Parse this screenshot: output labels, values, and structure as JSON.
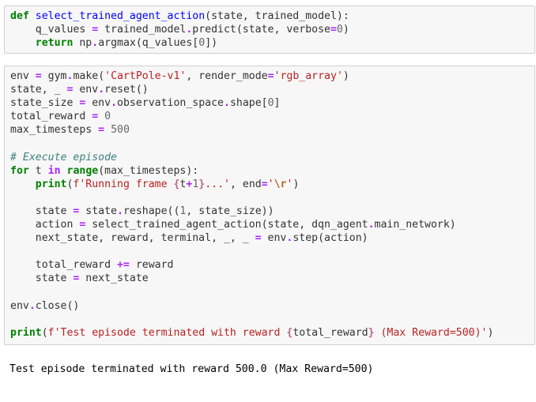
{
  "cells": [
    {
      "lines": [
        [
          {
            "t": "def",
            "c": "kw"
          },
          {
            "t": " ",
            "c": "plain"
          },
          {
            "t": "select_trained_agent_action",
            "c": "fn"
          },
          {
            "t": "(state, trained_model):",
            "c": "plain"
          }
        ],
        [
          {
            "t": "    q_values ",
            "c": "plain"
          },
          {
            "t": "=",
            "c": "op"
          },
          {
            "t": " trained_model",
            "c": "plain"
          },
          {
            "t": ".",
            "c": "op"
          },
          {
            "t": "predict(state, verbose",
            "c": "plain"
          },
          {
            "t": "=",
            "c": "op"
          },
          {
            "t": "0",
            "c": "num"
          },
          {
            "t": ")",
            "c": "plain"
          }
        ],
        [
          {
            "t": "    ",
            "c": "plain"
          },
          {
            "t": "return",
            "c": "kw"
          },
          {
            "t": " np",
            "c": "plain"
          },
          {
            "t": ".",
            "c": "op"
          },
          {
            "t": "argmax(q_values[",
            "c": "plain"
          },
          {
            "t": "0",
            "c": "num"
          },
          {
            "t": "])",
            "c": "plain"
          }
        ]
      ]
    },
    {
      "lines": [
        [
          {
            "t": "env ",
            "c": "plain"
          },
          {
            "t": "=",
            "c": "op"
          },
          {
            "t": " gym",
            "c": "plain"
          },
          {
            "t": ".",
            "c": "op"
          },
          {
            "t": "make(",
            "c": "plain"
          },
          {
            "t": "'CartPole-v1'",
            "c": "str"
          },
          {
            "t": ", render_mode",
            "c": "plain"
          },
          {
            "t": "=",
            "c": "op"
          },
          {
            "t": "'rgb_array'",
            "c": "str"
          },
          {
            "t": ")",
            "c": "plain"
          }
        ],
        [
          {
            "t": "state, _ ",
            "c": "plain"
          },
          {
            "t": "=",
            "c": "op"
          },
          {
            "t": " env",
            "c": "plain"
          },
          {
            "t": ".",
            "c": "op"
          },
          {
            "t": "reset()",
            "c": "plain"
          }
        ],
        [
          {
            "t": "state_size ",
            "c": "plain"
          },
          {
            "t": "=",
            "c": "op"
          },
          {
            "t": " env",
            "c": "plain"
          },
          {
            "t": ".",
            "c": "op"
          },
          {
            "t": "observation_space",
            "c": "plain"
          },
          {
            "t": ".",
            "c": "op"
          },
          {
            "t": "shape[",
            "c": "plain"
          },
          {
            "t": "0",
            "c": "num"
          },
          {
            "t": "]",
            "c": "plain"
          }
        ],
        [
          {
            "t": "total_reward ",
            "c": "plain"
          },
          {
            "t": "=",
            "c": "op"
          },
          {
            "t": " ",
            "c": "plain"
          },
          {
            "t": "0",
            "c": "num"
          }
        ],
        [
          {
            "t": "max_timesteps ",
            "c": "plain"
          },
          {
            "t": "=",
            "c": "op"
          },
          {
            "t": " ",
            "c": "plain"
          },
          {
            "t": "500",
            "c": "num"
          }
        ],
        [],
        [
          {
            "t": "# Execute episode",
            "c": "cmt"
          }
        ],
        [
          {
            "t": "for",
            "c": "kw"
          },
          {
            "t": " t ",
            "c": "plain"
          },
          {
            "t": "in",
            "c": "op"
          },
          {
            "t": " ",
            "c": "plain"
          },
          {
            "t": "range",
            "c": "kw"
          },
          {
            "t": "(max_timesteps):",
            "c": "plain"
          }
        ],
        [
          {
            "t": "    ",
            "c": "plain"
          },
          {
            "t": "print",
            "c": "kw"
          },
          {
            "t": "(",
            "c": "plain"
          },
          {
            "t": "f'Running frame ",
            "c": "str"
          },
          {
            "t": "{",
            "c": "interp"
          },
          {
            "t": "t",
            "c": "plain"
          },
          {
            "t": "+",
            "c": "op"
          },
          {
            "t": "1",
            "c": "num"
          },
          {
            "t": "}",
            "c": "interp"
          },
          {
            "t": "...'",
            "c": "str"
          },
          {
            "t": ", end",
            "c": "plain"
          },
          {
            "t": "=",
            "c": "op"
          },
          {
            "t": "'",
            "c": "str"
          },
          {
            "t": "\\r",
            "c": "esc"
          },
          {
            "t": "'",
            "c": "str"
          },
          {
            "t": ")",
            "c": "plain"
          }
        ],
        [],
        [
          {
            "t": "    state ",
            "c": "plain"
          },
          {
            "t": "=",
            "c": "op"
          },
          {
            "t": " state",
            "c": "plain"
          },
          {
            "t": ".",
            "c": "op"
          },
          {
            "t": "reshape((",
            "c": "plain"
          },
          {
            "t": "1",
            "c": "num"
          },
          {
            "t": ", state_size))",
            "c": "plain"
          }
        ],
        [
          {
            "t": "    action ",
            "c": "plain"
          },
          {
            "t": "=",
            "c": "op"
          },
          {
            "t": " select_trained_agent_action(state, dqn_agent",
            "c": "plain"
          },
          {
            "t": ".",
            "c": "op"
          },
          {
            "t": "main_network)",
            "c": "plain"
          }
        ],
        [
          {
            "t": "    next_state, reward, terminal, _, _ ",
            "c": "plain"
          },
          {
            "t": "=",
            "c": "op"
          },
          {
            "t": " env",
            "c": "plain"
          },
          {
            "t": ".",
            "c": "op"
          },
          {
            "t": "step(action)",
            "c": "plain"
          }
        ],
        [],
        [
          {
            "t": "    total_reward ",
            "c": "plain"
          },
          {
            "t": "+=",
            "c": "op"
          },
          {
            "t": " reward",
            "c": "plain"
          }
        ],
        [
          {
            "t": "    state ",
            "c": "plain"
          },
          {
            "t": "=",
            "c": "op"
          },
          {
            "t": " next_state",
            "c": "plain"
          }
        ],
        [],
        [
          {
            "t": "env",
            "c": "plain"
          },
          {
            "t": ".",
            "c": "op"
          },
          {
            "t": "close()",
            "c": "plain"
          }
        ],
        [],
        [
          {
            "t": "print",
            "c": "kw"
          },
          {
            "t": "(",
            "c": "plain"
          },
          {
            "t": "f'Test episode terminated with reward ",
            "c": "str"
          },
          {
            "t": "{",
            "c": "interp"
          },
          {
            "t": "total_reward",
            "c": "plain"
          },
          {
            "t": "}",
            "c": "interp"
          },
          {
            "t": " (Max Reward=500)'",
            "c": "str"
          },
          {
            "t": ")",
            "c": "plain"
          }
        ]
      ]
    }
  ],
  "output": {
    "text": "Test episode terminated with reward 500.0 (Max Reward=500)"
  }
}
